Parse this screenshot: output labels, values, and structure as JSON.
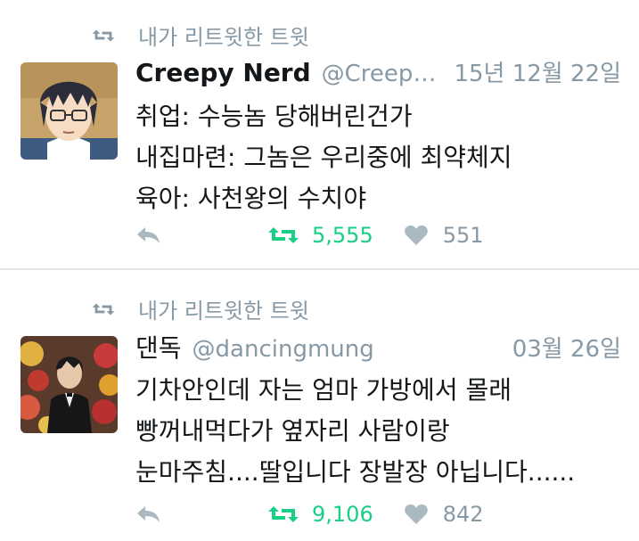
{
  "colors": {
    "retweet_green": "#19cf86",
    "meta_gray": "#8899a6",
    "divider": "#e1e8ed"
  },
  "tweets": [
    {
      "retweet_context": "내가 리트윗한 트윗",
      "name": "Creepy Nerd",
      "handle": "@Creepy_N...",
      "date": "15년 12월 22일",
      "lines": [
        "취업: 수능놈 당해버린건가",
        "내집마련: 그놈은 우리중에 최약체지",
        "육아: 사천왕의 수치야"
      ],
      "retweets": "5,555",
      "likes": "551",
      "avatar": "anime-character-avatar"
    },
    {
      "retweet_context": "내가 리트윗한 트윗",
      "name": "댄독",
      "handle": "@dancingmung",
      "date": "03월 26일",
      "lines": [
        "기차안인데 자는 엄마 가방에서 몰래",
        "빵꺼내먹다가 옆자리 사람이랑",
        "눈마주침....딸입니다 장발장 아닙니다......"
      ],
      "retweets": "9,106",
      "likes": "842",
      "avatar": "photo-avatar-flowers"
    }
  ]
}
